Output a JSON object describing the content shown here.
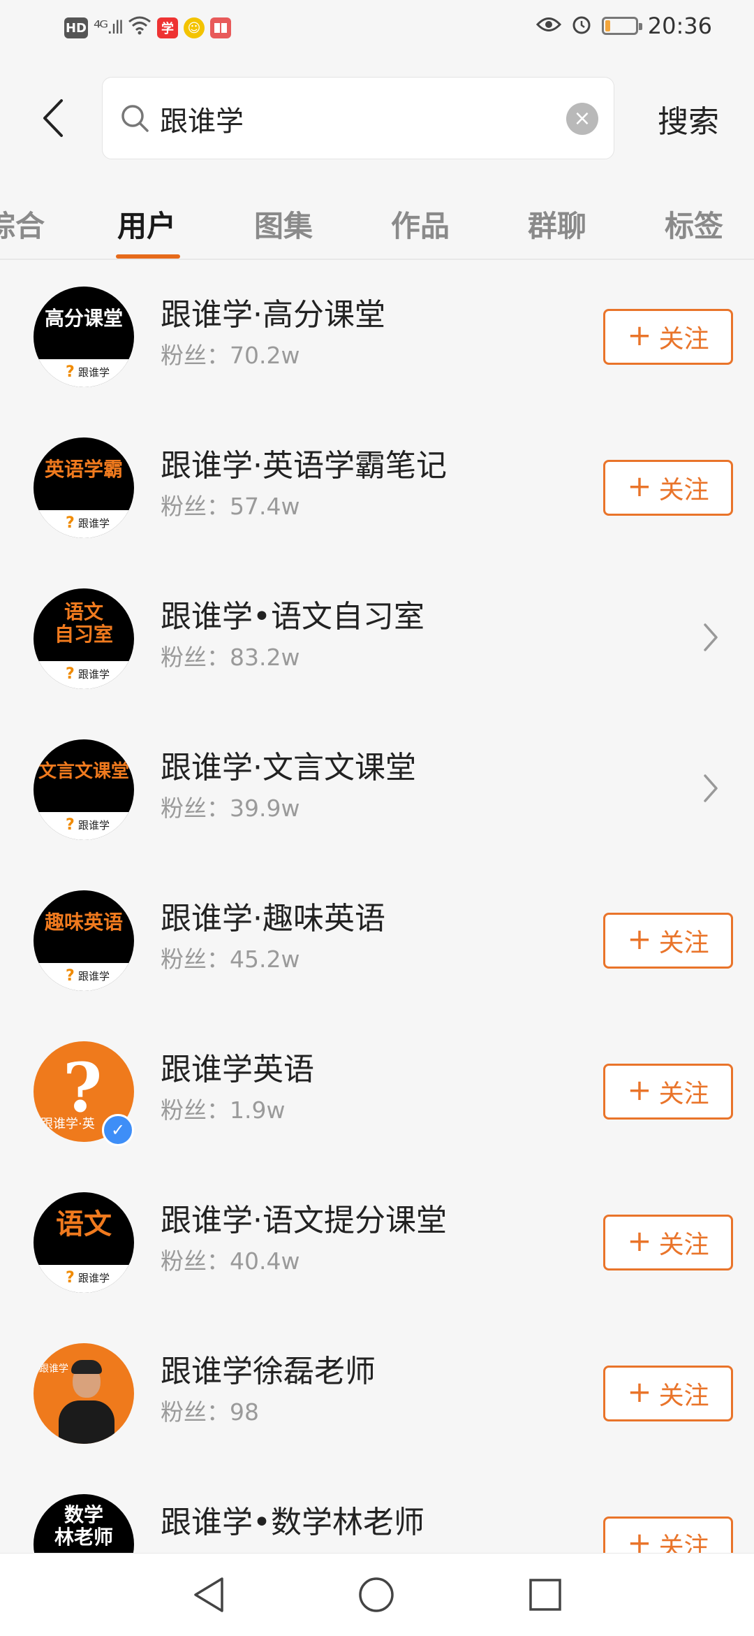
{
  "status_bar": {
    "left": {
      "hd": "HD",
      "signal": "⁴ᴳ.ıll",
      "icon3": "学",
      "icon4": "☺",
      "icon5": "📖"
    },
    "time": "20:36",
    "battery_level": 0.15
  },
  "search": {
    "query": "跟谁学",
    "submit_label": "搜索"
  },
  "tabs": [
    {
      "label": "综合"
    },
    {
      "label": "用户"
    },
    {
      "label": "图集"
    },
    {
      "label": "作品"
    },
    {
      "label": "群聊"
    },
    {
      "label": "标签"
    }
  ],
  "active_tab": "用户",
  "follow_label": "关注",
  "follow_plus": "+",
  "users": [
    {
      "name": "跟谁学·高分课堂",
      "fans": "粉丝：70.2w",
      "avatar_text": "高分课堂",
      "action": "follow"
    },
    {
      "name": "跟谁学·英语学霸笔记",
      "fans": "粉丝：57.4w",
      "avatar_text": "英语学霸",
      "action": "follow"
    },
    {
      "name": "跟谁学•语文自习室",
      "fans": "粉丝：83.2w",
      "avatar_text": "语文 自习室",
      "action": "open"
    },
    {
      "name": "跟谁学·文言文课堂",
      "fans": "粉丝：39.9w",
      "avatar_text": "文言文课堂",
      "action": "open"
    },
    {
      "name": "跟谁学·趣味英语",
      "fans": "粉丝：45.2w",
      "avatar_text": "趣味英语",
      "action": "follow"
    },
    {
      "name": "跟谁学英语",
      "fans": "粉丝：1.9w",
      "avatar_text": "跟谁学·英",
      "action": "follow",
      "verified": true
    },
    {
      "name": "跟谁学·语文提分课堂",
      "fans": "粉丝：40.4w",
      "avatar_text": "语文",
      "action": "follow"
    },
    {
      "name": "跟谁学徐磊老师",
      "fans": "粉丝：98",
      "avatar_text": "跟谁学",
      "action": "follow"
    },
    {
      "name": "跟谁学•数学林老师",
      "fans": "",
      "avatar_text": "数学 林老师",
      "action": "follow"
    }
  ],
  "avatar_brand": "跟谁学",
  "avatar_q": "?",
  "colors": {
    "accent": "#e9742a",
    "verified": "#3e8ef7"
  }
}
